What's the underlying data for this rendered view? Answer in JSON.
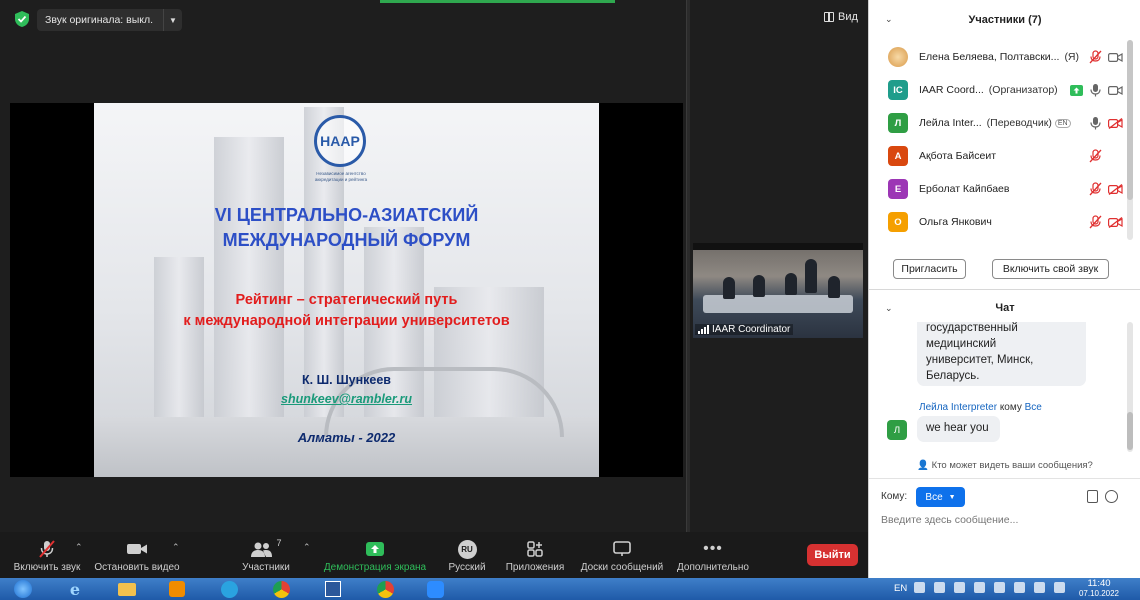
{
  "meeting": {
    "audio_pill": "Звук оригинала: выкл.",
    "view_label": "Вид",
    "self_video_name": "IAAR Coordinator"
  },
  "slide": {
    "logo": "НААР",
    "logo_sub": "Независимое агентство аккредитации и рейтинга",
    "title_line1": "VI ЦЕНТРАЛЬНО-АЗИАТСКИЙ",
    "title_line2": "МЕЖДУНАРОДНЫЙ ФОРУМ",
    "subtitle_line1": "Рейтинг – стратегический путь",
    "subtitle_line2": "к международной интеграции университетов",
    "author": "К. Ш. Шункеев",
    "email": "shunkeev@rambler.ru",
    "city": "Алматы - 2022"
  },
  "toolbar": {
    "unmute": "Включить звук",
    "stop_video": "Остановить видео",
    "participants": "Участники",
    "participants_count": "7",
    "share": "Демонстрация экрана",
    "language": "Русский",
    "language_badge": "RU",
    "apps": "Приложения",
    "whiteboards": "Доски сообщений",
    "more": "Дополнительно",
    "leave": "Выйти"
  },
  "participants": {
    "title": "Участники (7)",
    "items": [
      {
        "initial": "",
        "name": "Елена Беляева, Полтавски...",
        "role": "(Я)",
        "color": "#e8c07a",
        "mic": "muted",
        "cam": "on"
      },
      {
        "initial": "IC",
        "name": "IAAR Coord...",
        "role": "(Организатор)",
        "color": "#1f9d8b",
        "mic": "on",
        "cam": "on",
        "sharing": true
      },
      {
        "initial": "Л",
        "name": "Лейла Inter...",
        "role": "(Переводчик)",
        "color": "#2f9e44",
        "mic": "on",
        "cam": "off",
        "badge": "EN"
      },
      {
        "initial": "А",
        "name": "Ақбота Байсеит",
        "role": "",
        "color": "#d9480f",
        "mic": "muted",
        "cam": "none"
      },
      {
        "initial": "Е",
        "name": "Ерболат Кайпбаев",
        "role": "",
        "color": "#9c36b5",
        "mic": "muted",
        "cam": "off"
      },
      {
        "initial": "О",
        "name": "Ольга Янкович",
        "role": "",
        "color": "#f59f00",
        "mic": "muted",
        "cam": "off"
      }
    ],
    "invite": "Пригласить",
    "unmute_me": "Включить свой звук"
  },
  "chat": {
    "title": "Чат",
    "bubble1_line0": "государственный",
    "bubble1_line1": "медицинский",
    "bubble1_line2": "университет, Минск,",
    "bubble1_line3": "Беларусь.",
    "msg_sender": "Лейла Interpreter",
    "msg_to_word": "кому",
    "msg_recipient": "Все",
    "msg_initial": "Л",
    "msg_text": "we hear you",
    "who_can_see": "Кто может видеть ваши сообщения?",
    "to_label": "Кому:",
    "to_value": "Все",
    "input_placeholder": "Введите здесь сообщение..."
  },
  "taskbar": {
    "lang": "EN",
    "time": "11:40",
    "date": "07.10.2022"
  },
  "colors": {
    "accent_green": "#2fbd5a",
    "leave_red": "#d63131",
    "zoom_blue": "#0e71eb"
  }
}
